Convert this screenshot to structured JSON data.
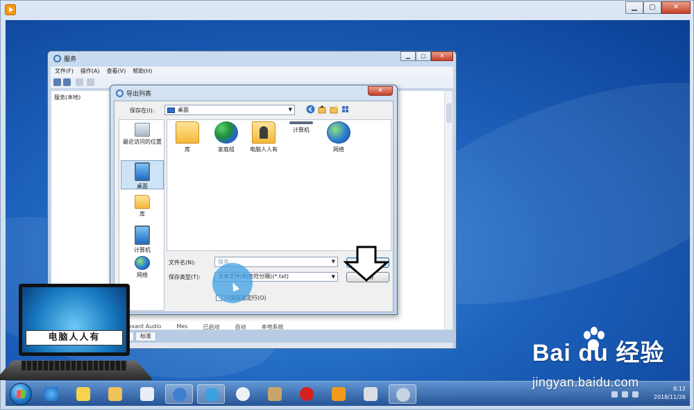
{
  "services_window": {
    "title": "服务",
    "menu": [
      "文件(F)",
      "操作(A)",
      "查看(V)",
      "帮助(H)"
    ],
    "tree_item": "服务(本地)",
    "bottom_row": [
      "Conexant Audio",
      "Mes",
      "已启动",
      "自动",
      "本地系统"
    ],
    "tabs": [
      "扩展",
      "标准"
    ]
  },
  "dialog": {
    "title": "导出列表",
    "look_in_label": "保存在(I):",
    "look_in_value": "桌面",
    "places": [
      {
        "label": "最近访问的位置",
        "icon": "recent-places-icon"
      },
      {
        "label": "桌面",
        "icon": "desktop-icon",
        "selected": true
      },
      {
        "label": "库",
        "icon": "library-icon"
      },
      {
        "label": "计算机",
        "icon": "computer-icon"
      },
      {
        "label": "网络",
        "icon": "network-icon"
      }
    ],
    "files": [
      {
        "label": "库",
        "icon": "library-folder-icon"
      },
      {
        "label": "家庭组",
        "icon": "homegroup-icon"
      },
      {
        "label": "电脑人人有",
        "icon": "user-folder-icon"
      },
      {
        "label": "计算机",
        "icon": "computer-icon"
      },
      {
        "label": "网络",
        "icon": "network-globe-icon"
      }
    ],
    "filename_label": "文件名(N):",
    "filename_value": "服务",
    "filetype_label": "保存类型(T):",
    "filetype_value": "文本文件(制表符分隔)(*.txt)",
    "save_button": "保存(S)",
    "cancel_button": "取消",
    "checkbox_label": "只保存选定行(O)"
  },
  "taskbar": {
    "time": "8:12",
    "date": "2018/11/26"
  },
  "overlay": {
    "laptop_label": "电脑人人有",
    "baidu_brand": "Bai du 经验",
    "baidu_url": "jingyan.baidu.com"
  },
  "colors": {
    "accent": "#3c7fb1",
    "desktop": "#1d63bd"
  }
}
